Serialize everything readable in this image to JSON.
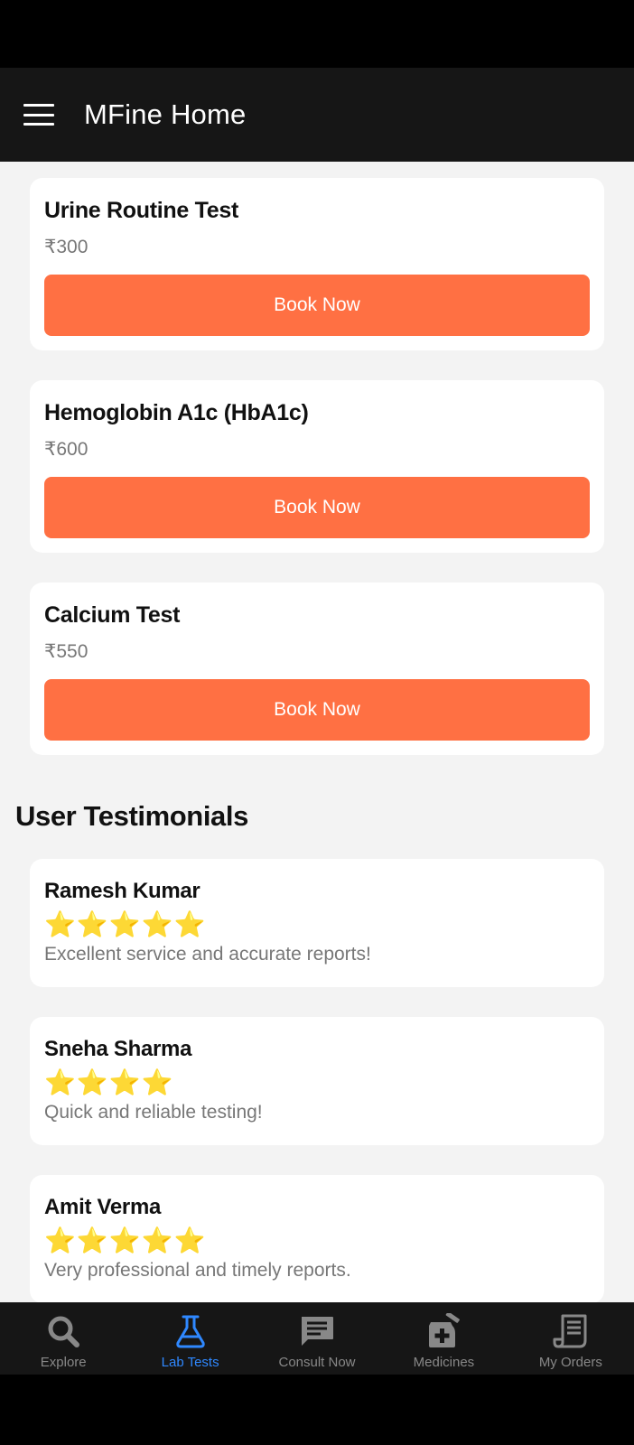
{
  "app_bar": {
    "title": "MFine Home"
  },
  "lab_tests": [
    {
      "name": "Urine Routine Test",
      "price": "₹300",
      "button": "Book Now"
    },
    {
      "name": "Hemoglobin A1c (HbA1c)",
      "price": "₹600",
      "button": "Book Now"
    },
    {
      "name": "Calcium Test",
      "price": "₹550",
      "button": "Book Now"
    }
  ],
  "testimonials": {
    "title": "User Testimonials",
    "items": [
      {
        "name": "Ramesh Kumar",
        "stars": "⭐⭐⭐⭐⭐",
        "rating": 5,
        "text": "Excellent service and accurate reports!"
      },
      {
        "name": "Sneha Sharma",
        "stars": "⭐⭐⭐⭐",
        "rating": 4,
        "text": "Quick and reliable testing!"
      },
      {
        "name": "Amit Verma",
        "stars": "⭐⭐⭐⭐⭐",
        "rating": 5,
        "text": "Very professional and timely reports."
      }
    ]
  },
  "bottom_nav": {
    "items": [
      {
        "label": "Explore",
        "icon": "search-icon"
      },
      {
        "label": "Lab Tests",
        "icon": "flask-icon",
        "active": true
      },
      {
        "label": "Consult Now",
        "icon": "chat-icon"
      },
      {
        "label": "Medicines",
        "icon": "medicine-icon"
      },
      {
        "label": "My Orders",
        "icon": "receipt-icon"
      }
    ]
  },
  "colors": {
    "accent": "#ff7043",
    "active_nav": "#2f88ff",
    "star": "#f7c531",
    "app_bar": "#161616"
  }
}
